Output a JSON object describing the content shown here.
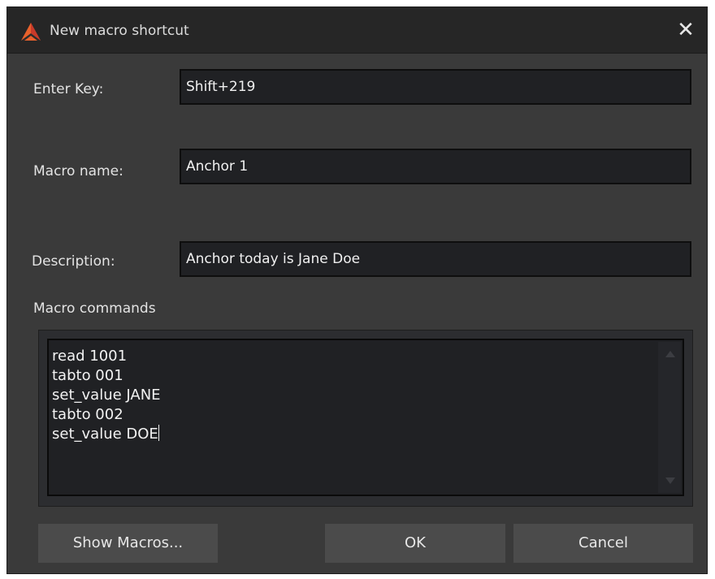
{
  "window": {
    "title": "New macro shortcut",
    "close_icon": "close-icon",
    "logo_icon": "app-logo-icon"
  },
  "form": {
    "enter_key_label": "Enter Key:",
    "enter_key_value": "Shift+219",
    "macro_name_label": "Macro name:",
    "macro_name_value": "Anchor 1",
    "description_label": "Description:",
    "description_value": "Anchor today is Jane Doe",
    "commands_label": "Macro commands",
    "commands": [
      "read 1001",
      "tabto 001",
      "set_value JANE",
      "tabto 002",
      "set_value DOE"
    ]
  },
  "buttons": {
    "show_macros": "Show Macros...",
    "ok": "OK",
    "cancel": "Cancel"
  },
  "colors": {
    "window_bg": "#3a3a3a",
    "titlebar_bg": "#262626",
    "field_bg": "#202124",
    "button_bg": "#4b4b4b",
    "logo_orange": "#e8612c",
    "logo_red": "#c83a2a"
  }
}
